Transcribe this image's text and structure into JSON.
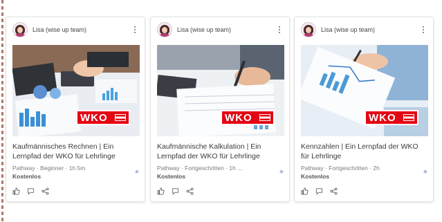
{
  "cards": [
    {
      "author": "Lisa (wise up team)",
      "title": "Kaufmännisches Rechnen | Ein Lernpfad der WKO für Lehrlinge",
      "meta": "Pathway · Beginner · 1h 5m",
      "price": "Kostenlos",
      "logo": "WKO"
    },
    {
      "author": "Lisa (wise up team)",
      "title": "Kaufmännische Kalkulation | Ein Lernpfad der WKO für Lehrlinge",
      "meta": "Pathway · Fortgeschritten · 1h ...",
      "price": "Kostenlos",
      "logo": "WKO"
    },
    {
      "author": "Lisa (wise up team)",
      "title": "Kennzahlen | Ein Lernpfad der WKO für Lehrlinge",
      "meta": "Pathway · Fortgeschritten · 2h",
      "price": "Kostenlos",
      "logo": "WKO"
    }
  ],
  "icons": [
    "user-avatar-icon",
    "more-options-icon",
    "star-icon",
    "like-icon",
    "comment-icon",
    "share-icon"
  ],
  "colors": {
    "wko_red": "#e30613",
    "star": "#9fb4d0"
  }
}
